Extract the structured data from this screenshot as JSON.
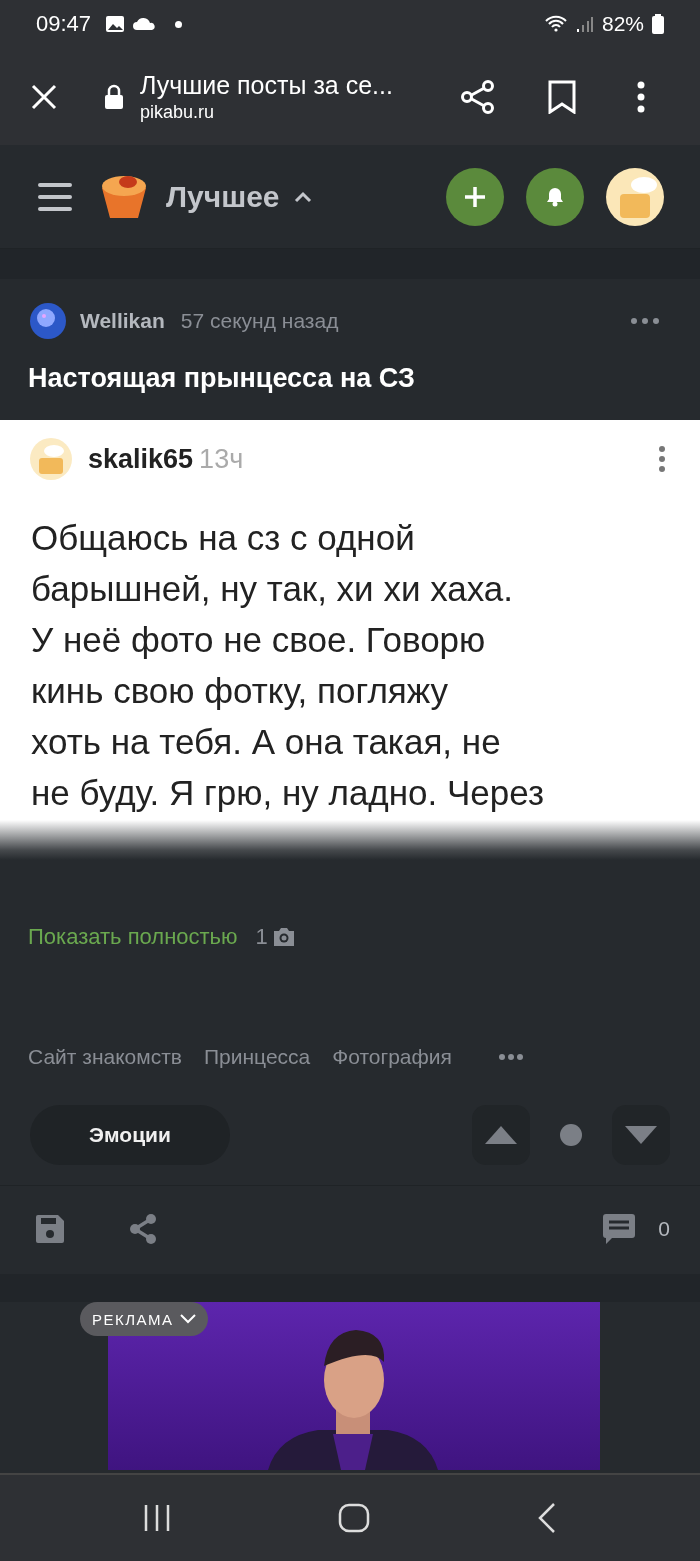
{
  "status_bar": {
    "time": "09:47",
    "battery": "82%"
  },
  "browser": {
    "title": "Лучшие посты за се...",
    "url": "pikabu.ru"
  },
  "app_header": {
    "section": "Лучшее",
    "expanded": true
  },
  "post": {
    "author": "Wellikan",
    "time": "57 секунд назад",
    "title": "Настоящая прынцесса на СЗ",
    "screenshot": {
      "author": "skalik65",
      "time": "13ч",
      "lines": [
        "Общаюсь на сз с одной",
        "барышней, ну так, хи хи хаха.",
        "У неё фото не свое. Говорю",
        "кинь свою фотку, погляжу",
        "хоть на тебя. А она такая, не",
        "не буду. Я грю, ну ладно. Через"
      ]
    },
    "show_full": "Показать полностью",
    "photo_count": "1",
    "tags": [
      "Сайт знакомств",
      "Принцесса",
      "Фотография"
    ],
    "emotions": "Эмоции",
    "comments": "0"
  },
  "ad": {
    "label": "РЕКЛАМА",
    "kind": "picture"
  }
}
